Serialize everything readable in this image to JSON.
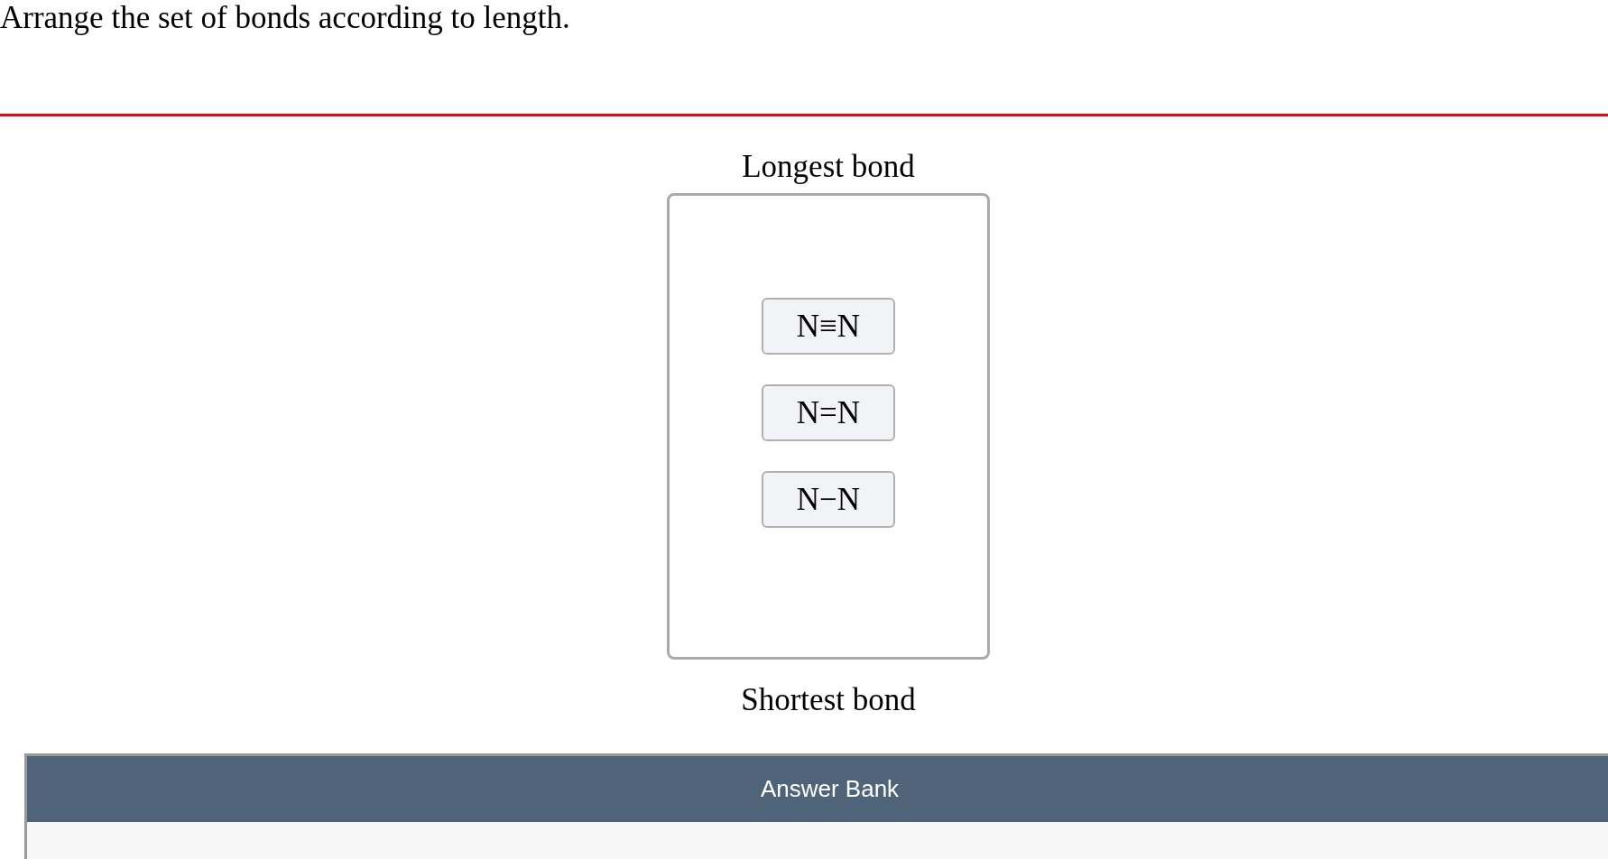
{
  "question": {
    "prompt": "Arrange the set of bonds according to length."
  },
  "ranking": {
    "top_label": "Longest bond",
    "items": [
      {
        "label": "N≡N"
      },
      {
        "label": "N=N"
      },
      {
        "label": "N−N"
      }
    ],
    "bottom_label": "Shortest bond"
  },
  "answer_bank": {
    "title": "Answer Bank"
  }
}
